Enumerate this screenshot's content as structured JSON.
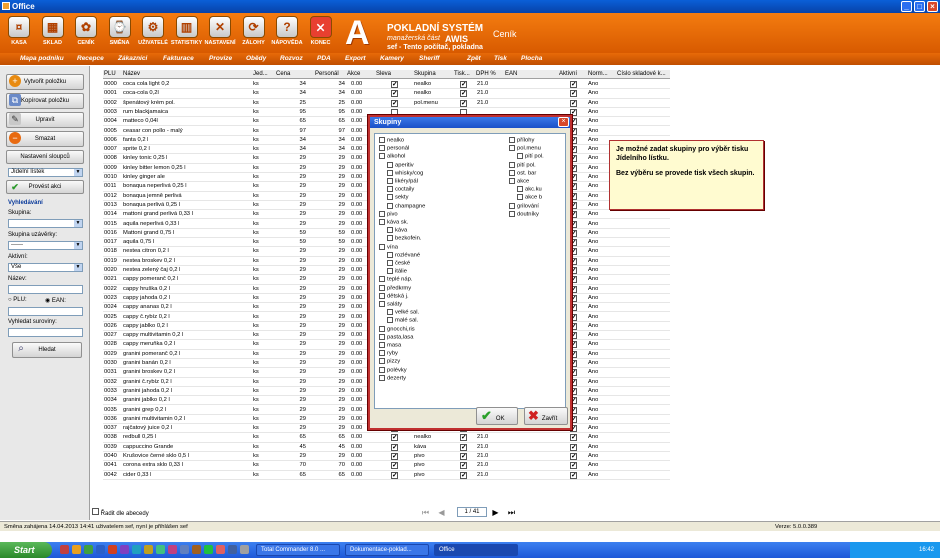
{
  "window": {
    "title": "Office"
  },
  "toolbar": {
    "buttons": [
      "KASA",
      "SKLAD",
      "CENÍK",
      "SMĚNA",
      "UŽIVATELÉ",
      "STATISTIKY",
      "NASTAVENÍ",
      "ZÁLOHY",
      "NÁPOVĚDA",
      "KONEC"
    ]
  },
  "brand": {
    "line1": "POKLADNÍ SYSTÉM",
    "line2": "manažerská část",
    "line3": "AWIS",
    "line4": "sef - Tento počítač, pokladna",
    "section": "Ceník"
  },
  "menu": [
    "Mapa podniku",
    "Recepce",
    "Zákazníci",
    "Fakturace",
    "Provize",
    "Obědy",
    "Rozvoz",
    "PDA",
    "Export",
    "Kamery",
    "Sheriff",
    "Zpět",
    "Tisk",
    "Plocha"
  ],
  "left": {
    "add": "Vytvořit položku",
    "copy": "Kopírovat položku",
    "edit": "Upravit",
    "delete": "Smazat",
    "columns": "Nastavení sloupců",
    "print_select": "Jídelní lístek",
    "print_btn": "Provést akci",
    "search_title": "Vyhledávání",
    "group_label": "Skupina:",
    "group_val": "",
    "lock_label": "Skupina uzávěrky:",
    "lock_val": "------",
    "active_label": "Aktivní:",
    "active_val": "Vše",
    "name_label": "Název:",
    "plu_label": "PLU:",
    "ean_label": "EAN:",
    "ingredient_label": "Vyhledat suroviny:",
    "search_btn": "Hledat",
    "sort_label": "Řadit dle abecedy"
  },
  "grid": {
    "headers": [
      "PLU",
      "Název",
      "Jed...",
      "Cena",
      "Personál",
      "Akce",
      "Sleva",
      "Skupina",
      "Tisk...",
      "DPH %",
      "EAN",
      "Aktivní",
      "Norm...",
      "Číslo skladové k..."
    ],
    "rows": [
      [
        "0000",
        "coca cola light 0,2",
        "ks",
        "34",
        "34",
        "0.00",
        "x",
        "nealko",
        "x",
        "21.0",
        "x",
        "Ano"
      ],
      [
        "0001",
        "coca-cola 0,2l",
        "ks",
        "34",
        "34",
        "0.00",
        "x",
        "nealko",
        "x",
        "21.0",
        "x",
        "Ano"
      ],
      [
        "0002",
        "špenátový krém pol.",
        "ks",
        "25",
        "25",
        "0.00",
        "x",
        "pol.menu",
        "x",
        "21.0",
        "x",
        "Ano"
      ],
      [
        "0003",
        "rum blackjamaica",
        "ks",
        "95",
        "95",
        "0.00",
        "",
        "",
        "",
        "",
        "x",
        "Ano"
      ],
      [
        "0004",
        "matteco 0,04l",
        "ks",
        "65",
        "65",
        "0.00",
        "",
        "",
        "",
        "",
        "x",
        "Ano"
      ],
      [
        "0005",
        "ceasar con pollo - malý",
        "ks",
        "97",
        "97",
        "0.00",
        "",
        "",
        "",
        "",
        "x",
        "Ano"
      ],
      [
        "0006",
        "fanta 0,2 l",
        "ks",
        "34",
        "34",
        "0.00",
        "",
        "",
        "",
        "",
        "x",
        "Ano"
      ],
      [
        "0007",
        "sprite 0,2 l",
        "ks",
        "34",
        "34",
        "0.00",
        "",
        "",
        "",
        "",
        "x",
        "Ano"
      ],
      [
        "0008",
        "kinley tonic 0,25 l",
        "ks",
        "29",
        "29",
        "0.00",
        "",
        "",
        "",
        "",
        "x",
        "Ano"
      ],
      [
        "0009",
        "kinley bitter lemon 0,25 l",
        "ks",
        "29",
        "29",
        "0.00",
        "",
        "",
        "",
        "",
        "x",
        "Ano"
      ],
      [
        "0010",
        "kinley ginger ale",
        "ks",
        "29",
        "29",
        "0.00",
        "",
        "",
        "",
        "",
        "x",
        "Ano"
      ],
      [
        "0011",
        "bonaqua neperlivá 0,25 l",
        "ks",
        "29",
        "29",
        "0.00",
        "",
        "",
        "",
        "",
        "x",
        "Ano"
      ],
      [
        "0012",
        "bonaqua jemně perlivá",
        "ks",
        "29",
        "29",
        "0.00",
        "",
        "",
        "",
        "",
        "x",
        "Ano"
      ],
      [
        "0013",
        "bonaqua perlivá 0,25 l",
        "ks",
        "29",
        "29",
        "0.00",
        "",
        "",
        "",
        "",
        "x",
        "Ano"
      ],
      [
        "0014",
        "mattoni grand perlivá 0,33 l",
        "ks",
        "29",
        "29",
        "0.00",
        "",
        "",
        "",
        "",
        "x",
        "Ano"
      ],
      [
        "0015",
        "aquila neperlivá 0,33 l",
        "ks",
        "29",
        "29",
        "0.00",
        "",
        "",
        "",
        "",
        "x",
        "Ano"
      ],
      [
        "0016",
        "Mattoni grand 0,75 l",
        "ks",
        "59",
        "59",
        "0.00",
        "",
        "",
        "",
        "",
        "x",
        "Ano"
      ],
      [
        "0017",
        "aquila 0,75 l",
        "ks",
        "59",
        "59",
        "0.00",
        "",
        "",
        "",
        "",
        "x",
        "Ano"
      ],
      [
        "0018",
        "nestea citron 0,2 l",
        "ks",
        "29",
        "29",
        "0.00",
        "",
        "",
        "",
        "",
        "x",
        "Ano"
      ],
      [
        "0019",
        "nestea broskev 0,2 l",
        "ks",
        "29",
        "29",
        "0.00",
        "",
        "",
        "",
        "",
        "x",
        "Ano"
      ],
      [
        "0020",
        "nestea zelený čaj 0,2 l",
        "ks",
        "29",
        "29",
        "0.00",
        "",
        "",
        "",
        "",
        "x",
        "Ano"
      ],
      [
        "0021",
        "cappy pomeranč 0,2 l",
        "ks",
        "29",
        "29",
        "0.00",
        "",
        "",
        "",
        "",
        "x",
        "Ano"
      ],
      [
        "0022",
        "cappy hruška 0,2 l",
        "ks",
        "29",
        "29",
        "0.00",
        "",
        "",
        "",
        "",
        "x",
        "Ano"
      ],
      [
        "0023",
        "cappy jahoda 0,2 l",
        "ks",
        "29",
        "29",
        "0.00",
        "",
        "",
        "",
        "",
        "x",
        "Ano"
      ],
      [
        "0024",
        "cappy ananas 0,2 l",
        "ks",
        "29",
        "29",
        "0.00",
        "",
        "",
        "",
        "",
        "x",
        "Ano"
      ],
      [
        "0025",
        "cappy č.rybíz 0,2 l",
        "ks",
        "29",
        "29",
        "0.00",
        "",
        "",
        "",
        "",
        "x",
        "Ano"
      ],
      [
        "0026",
        "cappy jablko 0,2 l",
        "ks",
        "29",
        "29",
        "0.00",
        "",
        "",
        "",
        "",
        "x",
        "Ano"
      ],
      [
        "0027",
        "cappy multivitamin 0,2 l",
        "ks",
        "29",
        "29",
        "0.00",
        "",
        "",
        "",
        "",
        "x",
        "Ano"
      ],
      [
        "0028",
        "cappy meruňka 0,2 l",
        "ks",
        "29",
        "29",
        "0.00",
        "",
        "",
        "",
        "",
        "x",
        "Ano"
      ],
      [
        "0029",
        "granini pomeranč 0,2 l",
        "ks",
        "29",
        "29",
        "0.00",
        "",
        "",
        "",
        "",
        "x",
        "Ano"
      ],
      [
        "0030",
        "granini banán 0,2 l",
        "ks",
        "29",
        "29",
        "0.00",
        "",
        "",
        "",
        "",
        "x",
        "Ano"
      ],
      [
        "0031",
        "granini broskev 0,2 l",
        "ks",
        "29",
        "29",
        "0.00",
        "",
        "",
        "",
        "",
        "x",
        "Ano"
      ],
      [
        "0032",
        "granini č.rybíz 0,2 l",
        "ks",
        "29",
        "29",
        "0.00",
        "",
        "",
        "",
        "",
        "x",
        "Ano"
      ],
      [
        "0033",
        "granini jahoda 0,2 l",
        "ks",
        "29",
        "29",
        "0.00",
        "",
        "",
        "",
        "",
        "x",
        "Ano"
      ],
      [
        "0034",
        "granini jablko 0,2 l",
        "ks",
        "29",
        "29",
        "0.00",
        "",
        "",
        "",
        "",
        "x",
        "Ano"
      ],
      [
        "0035",
        "granini grep 0,2 l",
        "ks",
        "29",
        "29",
        "0.00",
        "",
        "",
        "",
        "",
        "x",
        "Ano"
      ],
      [
        "0036",
        "granini multivitamin 0,2 l",
        "ks",
        "29",
        "29",
        "0.00",
        "",
        "",
        "",
        "",
        "x",
        "Ano"
      ],
      [
        "0037",
        "rajčatový juice 0,2 l",
        "ks",
        "29",
        "29",
        "0.00",
        "x",
        "nealko",
        "x",
        "21.0",
        "x",
        "Ano"
      ],
      [
        "0038",
        "redbull 0,25 l",
        "ks",
        "65",
        "65",
        "0.00",
        "x",
        "nealko",
        "x",
        "21.0",
        "x",
        "Ano"
      ],
      [
        "0039",
        "cappuccino Grande",
        "ks",
        "45",
        "45",
        "0.00",
        "x",
        "káva",
        "x",
        "21.0",
        "x",
        "Ano"
      ],
      [
        "0040",
        "Krušovice černé sklo 0,5 l",
        "ks",
        "29",
        "29",
        "0.00",
        "x",
        "pivo",
        "x",
        "21.0",
        "x",
        "Ano"
      ],
      [
        "0041",
        "corona extra sklo 0,33 l",
        "ks",
        "70",
        "70",
        "0.00",
        "x",
        "pivo",
        "x",
        "21.0",
        "x",
        "Ano"
      ],
      [
        "0042",
        "cider 0,33 l",
        "ks",
        "65",
        "65",
        "0.00",
        "x",
        "pivo",
        "x",
        "21.0",
        "x",
        "Ano"
      ]
    ]
  },
  "dialog": {
    "title": "Skupiny",
    "ok": "OK",
    "cancel": "Zavřít",
    "col1": [
      [
        "nealko",
        0
      ],
      [
        "personál",
        0
      ],
      [
        "alkohol",
        0
      ],
      [
        "aperitiv",
        1
      ],
      [
        "whisky/cog",
        1
      ],
      [
        "likéry/pál",
        1
      ],
      [
        "coctaily",
        1
      ],
      [
        "sekty",
        1
      ],
      [
        "champagne",
        1
      ],
      [
        "pivo",
        0
      ],
      [
        "káva sk.",
        0
      ],
      [
        "káva",
        1
      ],
      [
        "bezkofein.",
        1
      ],
      [
        "vína",
        0
      ],
      [
        "rozlévané",
        1
      ],
      [
        "české",
        1
      ],
      [
        "itálie",
        1
      ],
      [
        "teplé náp.",
        0
      ],
      [
        "předkrmy",
        0
      ],
      [
        "dětská j.",
        0
      ],
      [
        "saláty",
        0
      ],
      [
        "velké sal.",
        1
      ],
      [
        "malé sal.",
        1
      ],
      [
        "gnocchi,ris",
        0
      ],
      [
        "pasta,lasa",
        0
      ],
      [
        "masa",
        0
      ],
      [
        "ryby",
        0
      ],
      [
        "pizzy",
        0
      ],
      [
        "polévky",
        0
      ],
      [
        "dezerty",
        0
      ]
    ],
    "col2": [
      [
        "přílohy",
        0
      ],
      [
        "pol.menu",
        0
      ],
      [
        "pití pol.",
        1
      ],
      [
        "pití pol.",
        0
      ],
      [
        "ost. bar",
        0
      ],
      [
        "akce",
        0
      ],
      [
        "akc.ku",
        1
      ],
      [
        "akce b",
        1
      ],
      [
        "grilování",
        0
      ],
      [
        "doutníky",
        0
      ]
    ]
  },
  "note": {
    "p1": "Je možné zadat skupiny pro výběr tisku Jídelního lístku.",
    "p2": "Bez výběru se provede tisk všech skupin."
  },
  "pager": {
    "value": "1 / 41"
  },
  "status": {
    "left": "Směna zahájena 14.04.2013 14:41 uživatelem sef, nyní je přihlášen sef",
    "right": "Verze: 5.0.0.389"
  },
  "taskbar": {
    "start": "Start",
    "items": [
      "Total Commander 8.0 ...",
      "Dokumentace-poklad...",
      "Office"
    ],
    "clock": "16:42"
  }
}
